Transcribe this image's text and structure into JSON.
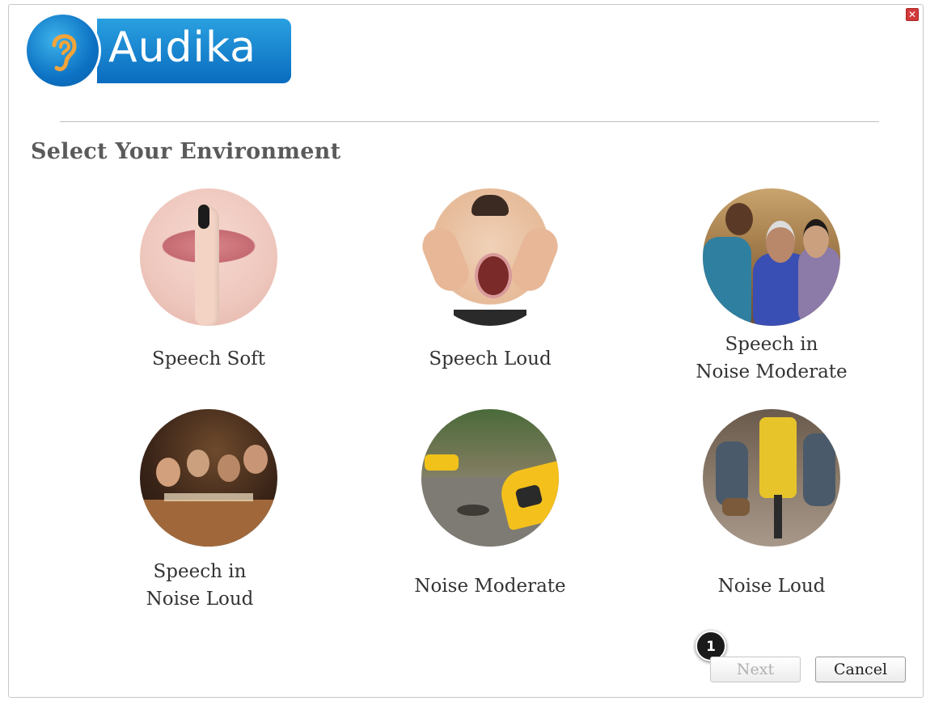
{
  "window": {
    "close_glyph": "✕"
  },
  "logo": {
    "text": "Audika",
    "icon": "ear-icon",
    "brand_color": "#0a6cbf"
  },
  "page_title": "Select Your Environment",
  "environments": [
    {
      "label": "Speech Soft",
      "photo": "finger-on-lips-photo"
    },
    {
      "label": "Speech Loud",
      "photo": "man-shouting-photo"
    },
    {
      "label": "Speech in\nNoise Moderate",
      "photo": "group-conversation-photo"
    },
    {
      "label": "Speech in\nNoise Loud",
      "photo": "restaurant-dinner-photo"
    },
    {
      "label": "Noise Moderate",
      "photo": "city-street-taxi-photo"
    },
    {
      "label": "Noise Loud",
      "photo": "jackhammer-photo"
    }
  ],
  "buttons": {
    "next_label": "Next",
    "next_enabled": false,
    "cancel_label": "Cancel"
  },
  "step_badge": "1"
}
